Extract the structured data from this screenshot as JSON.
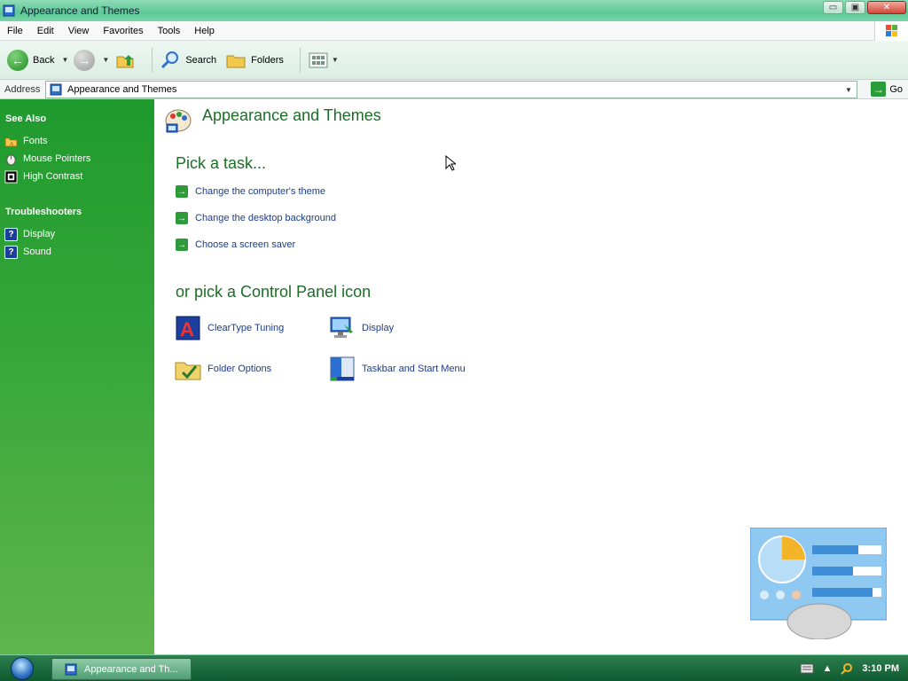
{
  "window": {
    "title": "Appearance and Themes",
    "controls": {
      "minimize": "▭",
      "maximize": "▣",
      "close": "✕"
    }
  },
  "menubar": {
    "items": [
      "File",
      "Edit",
      "View",
      "Favorites",
      "Tools",
      "Help"
    ]
  },
  "toolbar": {
    "back_label": "Back",
    "search_label": "Search",
    "folders_label": "Folders"
  },
  "address": {
    "label": "Address",
    "value": "Appearance and Themes",
    "go_label": "Go"
  },
  "sidebar": {
    "see_also": {
      "heading": "See Also",
      "items": [
        "Fonts",
        "Mouse Pointers",
        "High Contrast"
      ]
    },
    "troubleshooters": {
      "heading": "Troubleshooters",
      "items": [
        "Display",
        "Sound"
      ]
    }
  },
  "main": {
    "title": "Appearance and Themes",
    "pick_task_heading": "Pick a task...",
    "tasks": [
      "Change the computer's theme",
      "Change the desktop background",
      "Choose a screen saver"
    ],
    "icons_heading": "or pick a Control Panel icon",
    "icons": [
      "ClearType Tuning",
      "Display",
      "Folder Options",
      "Taskbar and Start Menu"
    ]
  },
  "taskbar": {
    "task_button": "Appearance and Th...",
    "clock": "3:10 PM"
  },
  "colors": {
    "accent_green": "#1c6e27",
    "link_blue": "#1b3c8a",
    "sidebar_green": "#1f9a2e"
  }
}
